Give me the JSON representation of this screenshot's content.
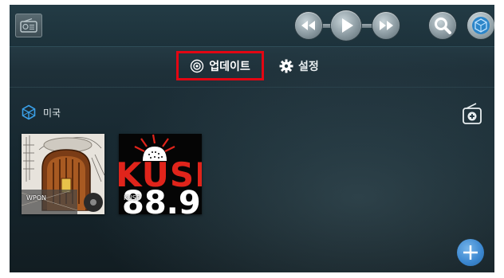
{
  "colors": {
    "highlight_border": "#e30613",
    "accent_blue": "#3aa0e8",
    "fab": "#3a86cf"
  },
  "topbar": {
    "radio_icon": "radio-icon",
    "controls": [
      "rewind-icon",
      "play-icon",
      "fast-forward-icon"
    ],
    "search_icon": "search-icon",
    "globe_icon": "globe-icon"
  },
  "tabs": [
    {
      "label": "업데이트",
      "icon": "target-icon",
      "highlighted": true
    },
    {
      "label": "설정",
      "icon": "gear-icon"
    }
  ],
  "section": {
    "title": "미국",
    "icon": "globe-outline-icon",
    "add_icon": "add-radio-icon"
  },
  "stations": [
    {
      "label": "WPON"
    },
    {
      "label": "KUSP",
      "logo_text": "KUSP",
      "frequency": "88.9"
    }
  ],
  "fab_icon": "plus-icon"
}
